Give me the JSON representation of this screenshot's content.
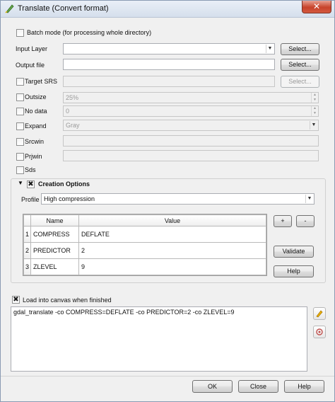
{
  "window": {
    "title": "Translate (Convert format)",
    "close_glyph": "✕",
    "icon": "qgis-translate-icon"
  },
  "batch_mode": {
    "label": "Batch mode (for processing whole directory)",
    "checked": false
  },
  "input_layer": {
    "label": "Input Layer",
    "value": "",
    "button": "Select..."
  },
  "output_file": {
    "label": "Output file",
    "value": "",
    "button": "Select..."
  },
  "target_srs": {
    "label": "Target SRS",
    "checked": false,
    "value": "",
    "button": "Select..."
  },
  "outsize": {
    "label": "Outsize",
    "checked": false,
    "value": "25%"
  },
  "no_data": {
    "label": "No data",
    "checked": false,
    "value": "0"
  },
  "expand": {
    "label": "Expand",
    "checked": false,
    "value": "Gray"
  },
  "srcwin": {
    "label": "Srcwin",
    "checked": false
  },
  "prjwin": {
    "label": "Prjwin",
    "checked": false
  },
  "sds": {
    "label": "Sds",
    "checked": false
  },
  "creation_options": {
    "title": "Creation Options",
    "enabled": true,
    "collapse_glyph": "▼",
    "profile_label": "Profile",
    "profile_value": "High compression",
    "columns": [
      "Name",
      "Value"
    ],
    "rows": [
      {
        "num": "1",
        "name": "COMPRESS",
        "value": "DEFLATE"
      },
      {
        "num": "2",
        "name": "PREDICTOR",
        "value": "2"
      },
      {
        "num": "3",
        "name": "ZLEVEL",
        "value": "9"
      }
    ],
    "add_label": "+",
    "remove_label": "-",
    "validate_label": "Validate",
    "help_label": "Help"
  },
  "load_canvas": {
    "label": "Load into canvas when finished",
    "checked": true
  },
  "command": "gdal_translate -co COMPRESS=DEFLATE -co PREDICTOR=2 -co ZLEVEL=9",
  "side_icons": {
    "edit": "pencil-icon",
    "reset": "reset-icon"
  },
  "buttons": {
    "ok": "OK",
    "close": "Close",
    "help": "Help"
  },
  "glyphs": {
    "check": "✖",
    "dropdown": "▼",
    "spin_up": "▲",
    "spin_down": "▼"
  }
}
